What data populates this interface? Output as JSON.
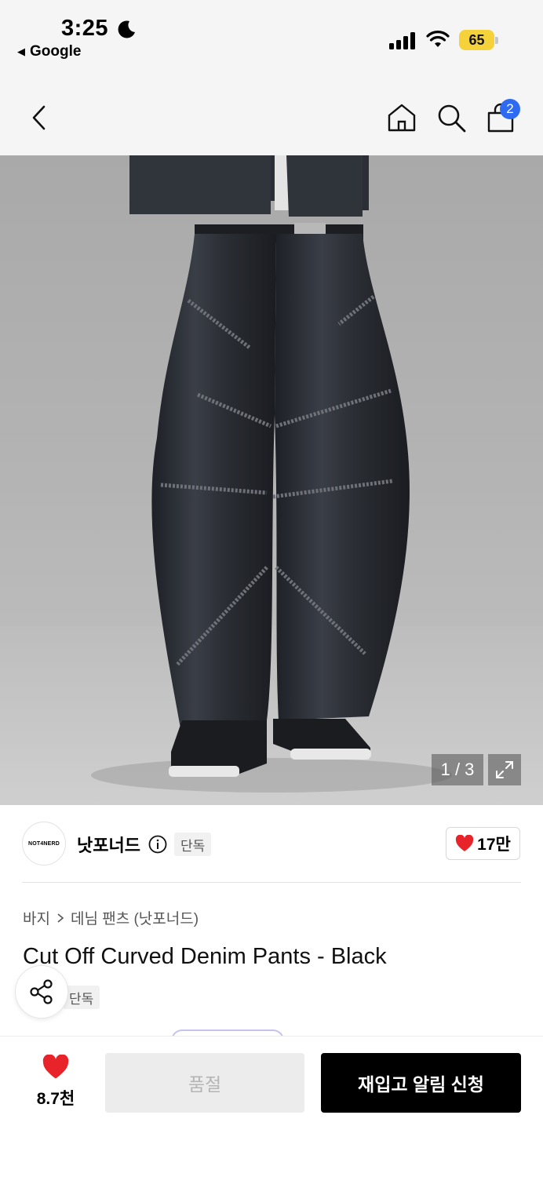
{
  "status_bar": {
    "time": "3:25",
    "back_app": "Google",
    "battery": "65"
  },
  "nav": {
    "cart_count": "2"
  },
  "gallery": {
    "counter": "1 / 3"
  },
  "brand": {
    "logo_text": "NOT4NERD",
    "name": "낫포너드",
    "tag": "단독",
    "likes": "17만"
  },
  "product": {
    "breadcrumb": [
      "바지",
      "데님 팬츠 (낫포너드)"
    ],
    "title": "Cut Off Curved Denim Pants - Black",
    "tag": "단독"
  },
  "bottom_bar": {
    "wish_count": "8.7천",
    "soldout_label": "품절",
    "restock_label": "재입고 알림 신청"
  },
  "colors": {
    "accent_blue": "#2f6bf2",
    "heart_red": "#e8232a",
    "battery_yellow": "#f6d23a"
  }
}
